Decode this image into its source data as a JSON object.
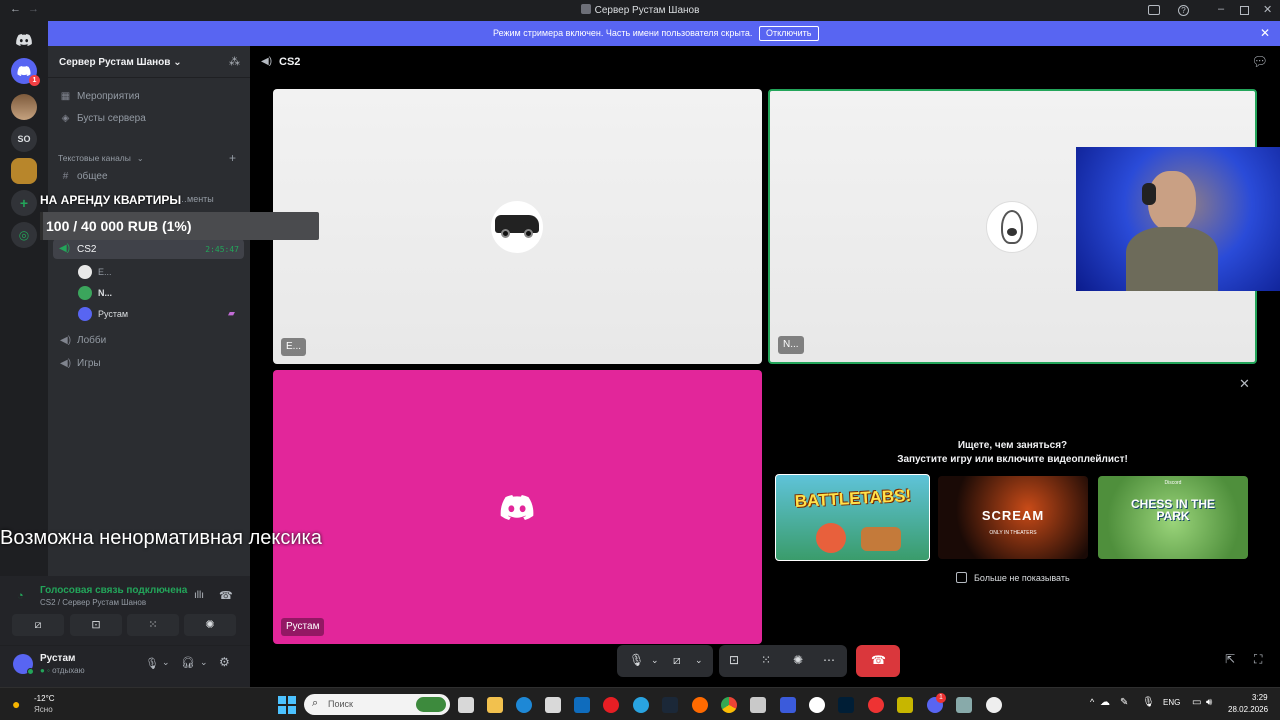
{
  "window": {
    "title": "Сервер Рустам Шанов",
    "back_glyph": "←",
    "forward_glyph": "→"
  },
  "banner": {
    "message": "Режим стримера включен. Часть имени пользователя скрыта.",
    "disable_label": "Отключить",
    "close_glyph": "✕",
    "color": "#5865f2"
  },
  "rail": {
    "items": [
      {
        "icon": "discord-home-icon"
      },
      {
        "icon": "discord-avatar-icon",
        "badge": "1"
      },
      {
        "icon": "user-avatar-icon"
      },
      {
        "label": "SO"
      },
      {
        "icon": "sand-server-icon"
      },
      {
        "icon": "add-server-icon",
        "glyph": "+"
      },
      {
        "icon": "explore-icon",
        "glyph": "◎"
      }
    ]
  },
  "sidebar": {
    "server_name": "Сервер Рустам Шанов",
    "chevron": "⌄",
    "top_items": [
      {
        "label": "Мероприятия",
        "icon": "calendar-icon"
      },
      {
        "label": "Бусты сервера",
        "icon": "boost-icon"
      }
    ],
    "category": "Текстовые каналы",
    "text_channels": [
      {
        "label": "общее"
      }
    ],
    "hidden_channel": "…менты",
    "voice_channel": {
      "label": "CS2",
      "time": "2:45:47"
    },
    "voice_users": [
      {
        "name": "E..."
      },
      {
        "name": "N..."
      },
      {
        "name": "Рустам"
      }
    ],
    "other_channels": [
      {
        "label": "Лобби"
      },
      {
        "label": "Игры"
      }
    ]
  },
  "voice_panel": {
    "status": "Голосовая связь подключена",
    "location": "CS2 / Сервер Рустам Шанов",
    "user_name": "Рустам",
    "user_status": "отдыхаю"
  },
  "main": {
    "channel": "CS2",
    "tiles": [
      {
        "label": "E..."
      },
      {
        "label": "N..."
      },
      {
        "label": "Рустам"
      }
    ],
    "activity": {
      "title": "Ищете, чем заняться?",
      "subtitle": "Запустите игру или включите видеоплейлист!",
      "games": [
        {
          "title": "BATTLETABS!"
        },
        {
          "title": "SCREAM",
          "tagline": "ONLY IN THEATERS"
        },
        {
          "title": "CHESS IN THE PARK",
          "brand": "Discord"
        }
      ],
      "dont_show": "Больше не показывать"
    }
  },
  "overlay": {
    "donation_title": "НА АРЕНДУ КВАРТИРЫ",
    "donation_progress": "100 / 40 000 RUB (1%)",
    "donation_fraction": 0.01,
    "warning": "Возможна ненормативная лексика"
  },
  "taskbar": {
    "weather_temp": "-12°C",
    "weather_desc": "Ясно",
    "search_placeholder": "Поиск",
    "lang": "ENG",
    "time": "3:29",
    "date": "28.02.2026",
    "discord_badge": "1"
  },
  "colors": {
    "accent": "#5865f2",
    "green": "#23a55a",
    "pink": "#e2269a",
    "hangup": "#da373c"
  }
}
